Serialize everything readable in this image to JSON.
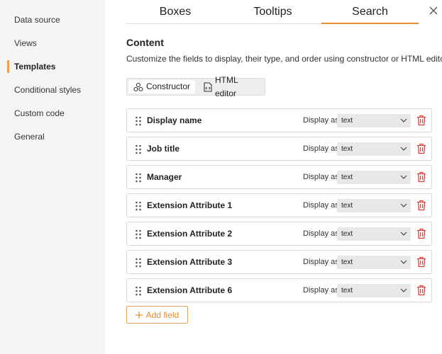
{
  "sidebar": {
    "items": [
      {
        "label": "Data source",
        "active": false
      },
      {
        "label": "Views",
        "active": false
      },
      {
        "label": "Templates",
        "active": true
      },
      {
        "label": "Conditional styles",
        "active": false
      },
      {
        "label": "Custom code",
        "active": false
      },
      {
        "label": "General",
        "active": false
      }
    ]
  },
  "tabs": [
    {
      "label": "Boxes",
      "active": false
    },
    {
      "label": "Tooltips",
      "active": false
    },
    {
      "label": "Search",
      "active": true
    }
  ],
  "content": {
    "title": "Content",
    "description": "Customize the fields to display, their type, and order using constructor or HTML editor"
  },
  "mode": {
    "constructor_label": "Constructor",
    "html_editor_label": "HTML editor",
    "selected": "Constructor"
  },
  "fields": [
    {
      "name": "Display name",
      "display_as_label": "Display as",
      "display_as": "text"
    },
    {
      "name": "Job title",
      "display_as_label": "Display as",
      "display_as": "text"
    },
    {
      "name": "Manager",
      "display_as_label": "Display as",
      "display_as": "text"
    },
    {
      "name": "Extension Attribute 1",
      "display_as_label": "Display as",
      "display_as": "text"
    },
    {
      "name": "Extension Attribute 2",
      "display_as_label": "Display as",
      "display_as": "text"
    },
    {
      "name": "Extension Attribute 3",
      "display_as_label": "Display as",
      "display_as": "text"
    },
    {
      "name": "Extension Attribute 6",
      "display_as_label": "Display as",
      "display_as": "text"
    }
  ],
  "add_field_label": "Add field",
  "colors": {
    "accent": "#e88a2e",
    "delete": "#d94040",
    "sidebar_bg": "#f5f5f5"
  },
  "icons": {
    "close": "close-icon",
    "drag": "drag-handle-icon",
    "trash": "trash-icon",
    "chevron": "chevron-down-icon",
    "plus": "plus-icon",
    "constructor": "constructor-icon",
    "html": "html-file-icon"
  }
}
